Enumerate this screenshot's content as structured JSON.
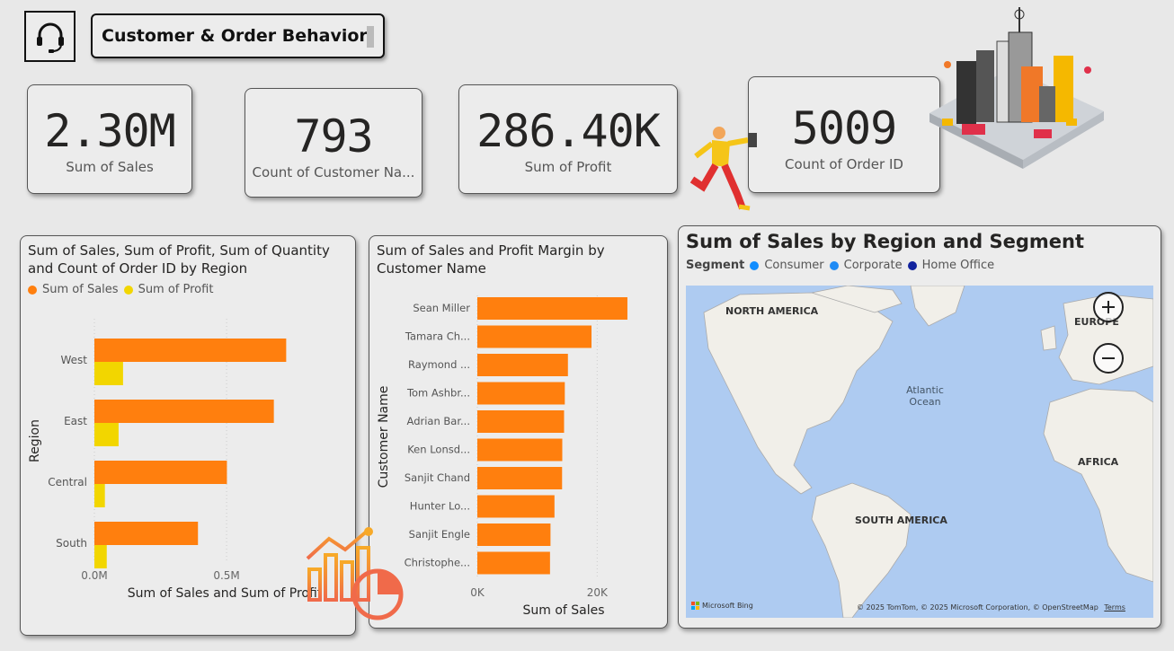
{
  "header": {
    "title": "Customer & Order Behavior"
  },
  "kpis": [
    {
      "value": "2.30M",
      "label": "Sum of Sales"
    },
    {
      "value": "793",
      "label": "Count of Customer Na..."
    },
    {
      "value": "286.40K",
      "label": "Sum of Profit"
    },
    {
      "value": "5009",
      "label": "Count of Order ID"
    }
  ],
  "colors": {
    "sales": "#ff7f0e",
    "profit": "#f2d600",
    "consumer": "#118dff",
    "corporate": "#1f8bf5",
    "home_office": "#12239e"
  },
  "region_chart": {
    "title": "Sum of Sales, Sum of Profit, Sum of Quantity and Count of Order ID by Region",
    "legend": [
      "Sum of Sales",
      "Sum of Profit"
    ],
    "xlabel": "Sum of Sales and Sum of Profit",
    "ylabel": "Region",
    "ticks": [
      "0.0M",
      "0.5M"
    ]
  },
  "customer_chart": {
    "title": "Sum of Sales and Profit Margin by Customer Name",
    "xlabel": "Sum of Sales",
    "ylabel": "Customer Name",
    "ticks": [
      "0K",
      "20K"
    ]
  },
  "map": {
    "title": "Sum of Sales by Region and Segment",
    "legend_title": "Segment",
    "legend": [
      "Consumer",
      "Corporate",
      "Home Office"
    ],
    "labels": {
      "na": "NORTH AMERICA",
      "eu": "EUROPE",
      "af": "AFRICA",
      "sa": "SOUTH AMERICA",
      "ocean": "Atlantic Ocean"
    },
    "bing": "Microsoft Bing",
    "attribution": "© 2025 TomTom, © 2025 Microsoft Corporation, © OpenStreetMap",
    "terms": "Terms"
  },
  "chart_data": [
    {
      "type": "bar",
      "orientation": "horizontal",
      "title": "Sum of Sales, Sum of Profit, Sum of Quantity and Count of Order ID by Region",
      "categories": [
        "West",
        "East",
        "Central",
        "South"
      ],
      "series": [
        {
          "name": "Sum of Sales",
          "values": [
            725458,
            678781,
            501240,
            391722
          ]
        },
        {
          "name": "Sum of Profit",
          "values": [
            108418,
            91523,
            39706,
            46750
          ]
        }
      ],
      "xlabel": "Sum of Sales and Sum of Profit",
      "ylabel": "Region",
      "xlim": [
        0,
        850000
      ]
    },
    {
      "type": "bar",
      "orientation": "horizontal",
      "title": "Sum of Sales and Profit Margin by Customer Name",
      "categories": [
        "Sean Miller",
        "Tamara Ch...",
        "Raymond ...",
        "Tom Ashbr...",
        "Adrian Bar...",
        "Ken Lonsd...",
        "Sanjit Chand",
        "Hunter Lo...",
        "Sanjit Engle",
        "Christophe..."
      ],
      "series": [
        {
          "name": "Sum of Sales",
          "values": [
            25043,
            19052,
            15117,
            14596,
            14474,
            14175,
            14142,
            12873,
            12209,
            12129
          ]
        }
      ],
      "xlabel": "Sum of Sales",
      "ylabel": "Customer Name",
      "xlim": [
        0,
        30000
      ]
    }
  ]
}
